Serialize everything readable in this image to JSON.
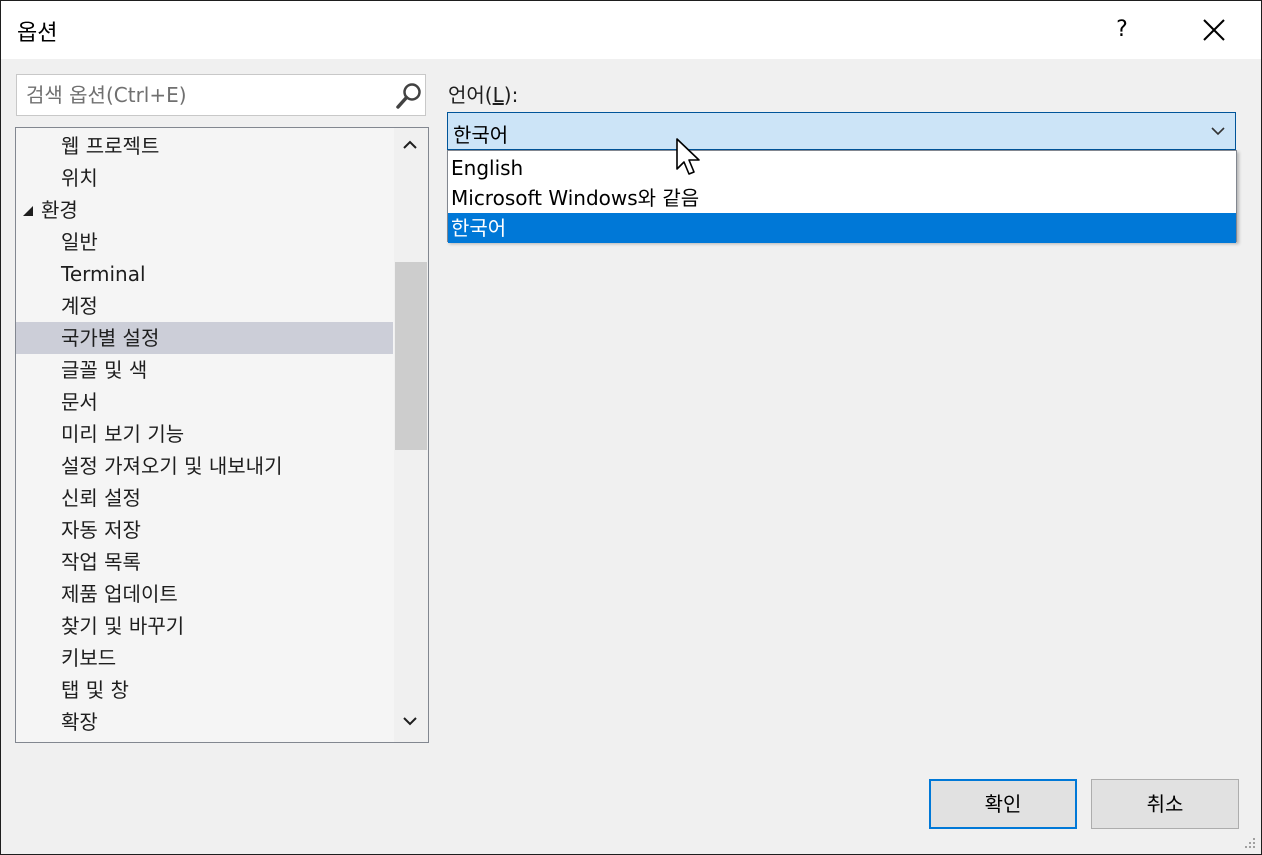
{
  "window": {
    "title": "옵션",
    "help_label": "?",
    "close_icon": "close-icon"
  },
  "search": {
    "value": "",
    "placeholder": "검색 옵션(Ctrl+E)"
  },
  "tree": {
    "items": [
      {
        "label": "웹 프로젝트",
        "level": 1,
        "selected": false
      },
      {
        "label": "위치",
        "level": 1,
        "selected": false
      },
      {
        "label": "환경",
        "level": 0,
        "expanded": true,
        "selected": false
      },
      {
        "label": "일반",
        "level": 1,
        "selected": false
      },
      {
        "label": "Terminal",
        "level": 1,
        "selected": false
      },
      {
        "label": "계정",
        "level": 1,
        "selected": false
      },
      {
        "label": "국가별 설정",
        "level": 1,
        "selected": true
      },
      {
        "label": "글꼴 및 색",
        "level": 1,
        "selected": false
      },
      {
        "label": "문서",
        "level": 1,
        "selected": false
      },
      {
        "label": "미리 보기 기능",
        "level": 1,
        "selected": false
      },
      {
        "label": "설정 가져오기 및 내보내기",
        "level": 1,
        "selected": false
      },
      {
        "label": "신뢰 설정",
        "level": 1,
        "selected": false
      },
      {
        "label": "자동 저장",
        "level": 1,
        "selected": false
      },
      {
        "label": "작업 목록",
        "level": 1,
        "selected": false
      },
      {
        "label": "제품 업데이트",
        "level": 1,
        "selected": false
      },
      {
        "label": "찾기 및 바꾸기",
        "level": 1,
        "selected": false
      },
      {
        "label": "키보드",
        "level": 1,
        "selected": false
      },
      {
        "label": "탭 및 창",
        "level": 1,
        "selected": false
      },
      {
        "label": "확장",
        "level": 1,
        "selected": false
      }
    ]
  },
  "language": {
    "label_prefix": "언어(",
    "label_accel": "L",
    "label_suffix": "):",
    "selected": "한국어",
    "options": [
      {
        "label": "English",
        "selected": false
      },
      {
        "label": "Microsoft Windows와 같음",
        "selected": false
      },
      {
        "label": "한국어",
        "selected": true
      }
    ]
  },
  "buttons": {
    "ok": "확인",
    "cancel": "취소"
  },
  "colors": {
    "selection_accent": "#0078d7",
    "tree_selected": "#ccced8",
    "combo_highlight": "#cce4f7"
  }
}
